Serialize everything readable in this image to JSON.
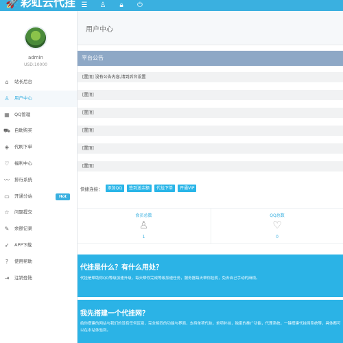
{
  "header": {
    "brand": "彩虹云代挂",
    "icons": [
      "menu-icon",
      "user-icon",
      "lock-icon",
      "power-icon"
    ]
  },
  "user": {
    "name": "admin",
    "balance": "USD:10000"
  },
  "sidebar": {
    "items": [
      {
        "label": "站长后台",
        "icon": "home-icon"
      },
      {
        "label": "用户中心",
        "icon": "user-icon",
        "active": true
      },
      {
        "label": "QQ管理",
        "icon": "grid-icon"
      },
      {
        "label": "自助购买",
        "icon": "cart-icon"
      },
      {
        "label": "代刷下单",
        "icon": "tag-icon"
      },
      {
        "label": "福利中心",
        "icon": "heart-icon"
      },
      {
        "label": "排行系统",
        "icon": "chart-icon"
      },
      {
        "label": "开通分站",
        "icon": "monitor-icon",
        "badge": "Hot"
      },
      {
        "label": "问题提交",
        "icon": "star-icon"
      },
      {
        "label": "余额记录",
        "icon": "edit-icon"
      },
      {
        "label": "APP下载",
        "icon": "rocket-icon"
      },
      {
        "label": "使用帮助",
        "icon": "help-icon"
      },
      {
        "label": "注销登陆",
        "icon": "logout-icon"
      }
    ]
  },
  "main": {
    "title": "用户中心",
    "notice_title": "平台公告",
    "notices": [
      "[置顶] 没有公告内容,请到后台设置",
      "[置顶]",
      "[置顶]",
      "[置顶]",
      "[置顶]",
      "[置顶]"
    ],
    "quick_label": "快捷连接：",
    "quick_links": [
      "添加QQ",
      "签到送余额",
      "代挂下单",
      "开通VIP"
    ],
    "stats": [
      {
        "label": "会员总数",
        "value": "1",
        "icon": "user-outline-icon"
      },
      {
        "label": "QQ总数",
        "value": "0",
        "icon": "heart-outline-icon"
      }
    ],
    "band1": {
      "title": "代挂是什么？有什么用处？",
      "text": "代挂是帮助你QQ等级加速升级，每天帮你完成等级加速任务，服务器每天帮你挂机，免去自己手动的麻烦。"
    },
    "band2": {
      "title": "我先搭建一个代挂网？",
      "text": "给你搭建的网站与我们的没有任何区别，完全相同的功能与界面，支持单项代挂，单项补挂，独家的推广功能，代理系统，一键搭建代挂网系统等，具体都可以在本站体验到。"
    }
  }
}
